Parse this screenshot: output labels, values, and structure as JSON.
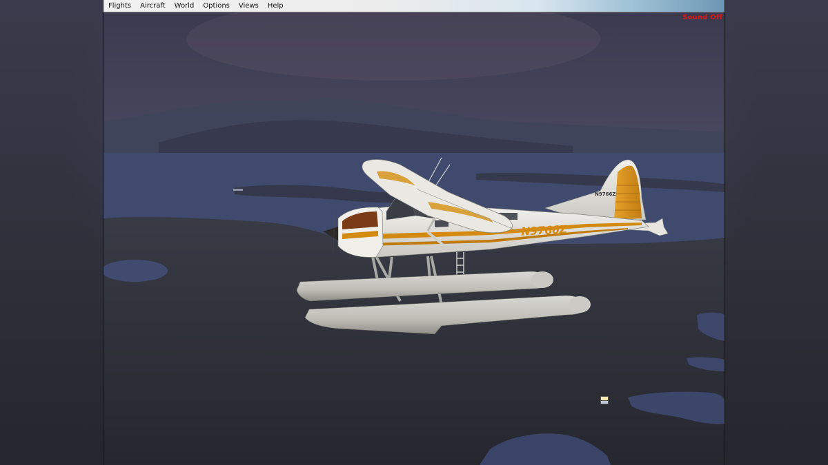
{
  "menubar": {
    "items": [
      "Flights",
      "Aircraft",
      "World",
      "Options",
      "Views",
      "Help"
    ]
  },
  "status": {
    "sound_label": "Sound Off"
  },
  "aircraft": {
    "tail_registration": "N9766Z",
    "side_registration": "N9766Z"
  },
  "colors": {
    "sound_label": "#e01818",
    "livery_stripe": "#d48a10",
    "water": "#3f4a6e",
    "land": "#2e2f38"
  },
  "icons": {
    "lod_indicator": "two-tone-square"
  }
}
